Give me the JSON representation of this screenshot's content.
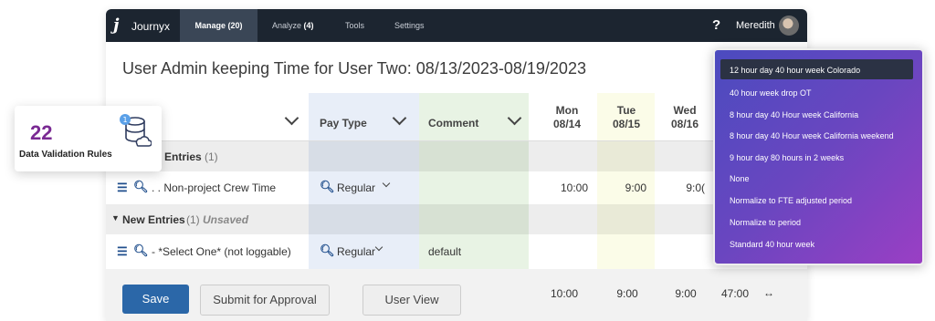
{
  "topbar": {
    "brand": "Journyx",
    "nav": [
      {
        "label": "Manage",
        "count": "(20)"
      },
      {
        "label": "Analyze",
        "count": "(4)"
      },
      {
        "label": "Tools",
        "count": ""
      },
      {
        "label": "Settings",
        "count": ""
      }
    ],
    "help": "?",
    "user": "Meredith"
  },
  "page_title": "User Admin keeping Time for User Two: 08/13/2023-08/19/2023",
  "columns": {
    "pay_type": "Pay Type",
    "comment": "Comment",
    "days": [
      {
        "name": "Mon",
        "date": "08/14"
      },
      {
        "name": "Tue",
        "date": "08/15"
      },
      {
        "name": "Wed",
        "date": "08/16"
      }
    ]
  },
  "sections": {
    "existing": {
      "label": "Entries",
      "count": "(1)"
    },
    "new": {
      "label": "New Entries",
      "count": "(1)",
      "status": "Unsaved"
    }
  },
  "rows": [
    {
      "project": ". . Non-project Crew Time",
      "pay_type": "Regular",
      "comment": "",
      "mon": "10:00",
      "tue": "9:00",
      "wed": "9:0("
    },
    {
      "project": "- *Select One* (not loggable)",
      "pay_type": "Regular",
      "comment": "default",
      "mon": "",
      "tue": "",
      "wed": ""
    }
  ],
  "totals": {
    "mon": "10:00",
    "tue": "9:00",
    "wed": "9:00",
    "week": "47:00",
    "arrow": "↔"
  },
  "buttons": {
    "save": "Save",
    "submit": "Submit for Approval",
    "user_view": "User View"
  },
  "card": {
    "number": "22",
    "label": "Data Validation Rules"
  },
  "dropdown": {
    "options": [
      "12 hour day 40 hour week Colorado",
      "40 hour week drop OT",
      "8 hour day 40 Hour week California",
      "8 hour day 40 Hour week California weekend",
      "9 hour day 80 hours in 2 weeks",
      "None",
      "Normalize to FTE adjusted period",
      "Normalize to period",
      "Standard 40 hour week"
    ],
    "selected_index": 0
  },
  "colors": {
    "topbar": "#1c2530",
    "save_button": "#2b67a8",
    "brand_purple": "#7a2a93"
  }
}
